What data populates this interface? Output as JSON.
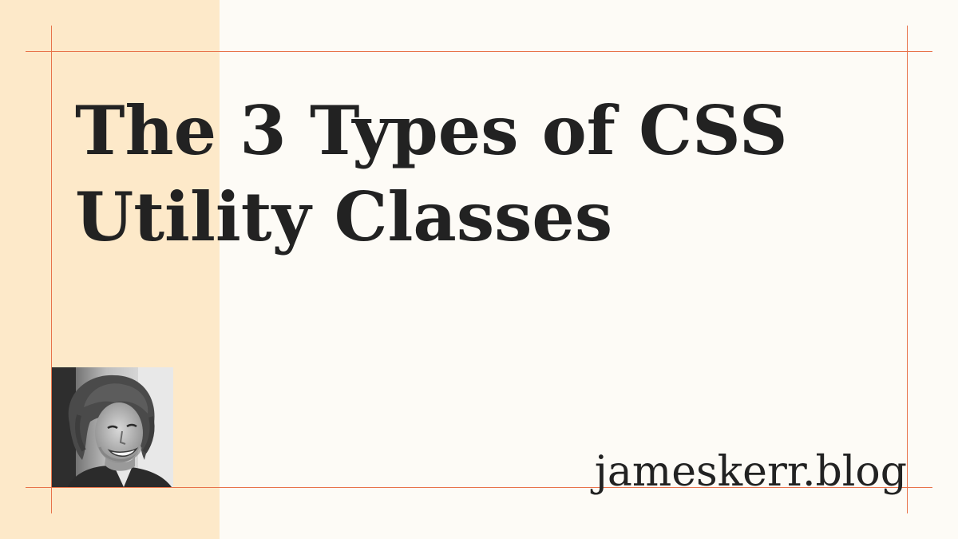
{
  "card": {
    "title_line_1": "The 3 Types of CSS",
    "title_line_2": "Utility Classes",
    "site": "jameskerr.blog",
    "avatar_alt": "Portrait of the author",
    "colors": {
      "background": "#fdfbf6",
      "band": "#fde9c9",
      "guide": "#e8734a",
      "text": "#222222"
    }
  }
}
